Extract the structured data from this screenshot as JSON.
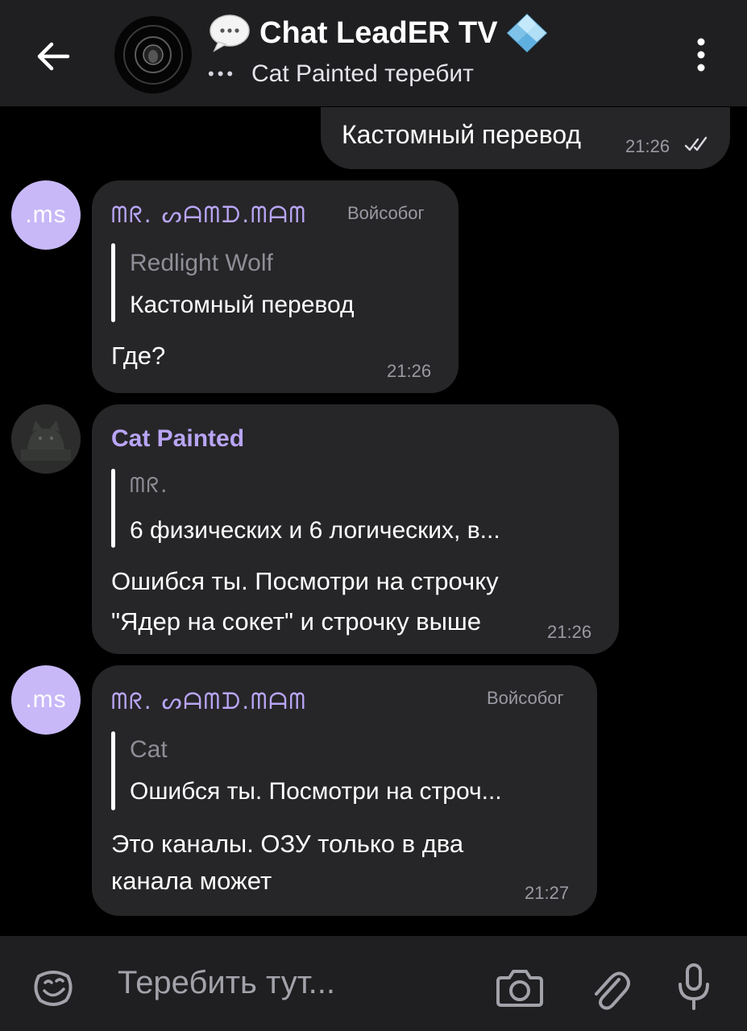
{
  "header": {
    "back_icon": "arrow-left-icon",
    "title_emoji_icon": "speech-bubble-icon",
    "title": "Chat LeadER TV",
    "verified_icon": "blue-diamond-icon",
    "typing_indicator": "•••",
    "typing_status": "Cat Painted теребит",
    "menu_icon": "more-vertical-icon"
  },
  "messages": [
    {
      "direction": "outgoing",
      "text": "Кастомный перевод",
      "time": "21:26",
      "status_icon": "double-check-icon"
    },
    {
      "direction": "incoming",
      "avatar_text": ".ms",
      "sender": "ᗰᖇ. ᔕᗩᗰᗪ.ᗰᗩᗰ",
      "role": "Войсобог",
      "quote": {
        "author": "Redlight Wolf",
        "text": "Кастомный перевод"
      },
      "text": "Где?",
      "time": "21:26"
    },
    {
      "direction": "incoming",
      "avatar_icon": "cat-avatar-icon",
      "sender": "Cat Painted",
      "quote": {
        "author": "ᗰᖇ.",
        "text": "6 физических и 6 логических, в..."
      },
      "text_lines": [
        "Ошибся ты. Посмотри на строчку",
        "\"Ядер на сокет\" и строчку выше"
      ],
      "time": "21:26"
    },
    {
      "direction": "incoming",
      "avatar_text": ".ms",
      "sender": "ᗰᖇ. ᔕᗩᗰᗪ.ᗰᗩᗰ",
      "role": "Войсобог",
      "quote": {
        "author": "Cat",
        "text": "Ошибся ты. Посмотри на строч..."
      },
      "text_lines": [
        "Это каналы. ОЗУ только в два",
        "канала может"
      ],
      "time": "21:27"
    }
  ],
  "input": {
    "emoji_icon": "sticker-smile-icon",
    "placeholder": "Теребить тут...",
    "camera_icon": "camera-icon",
    "attach_icon": "paperclip-icon",
    "mic_icon": "microphone-icon"
  },
  "colors": {
    "background": "#000000",
    "header": "#1f1f21",
    "bubble": "#262628",
    "accent": "#b9a5f5",
    "avatar_ms": "#c8b8f8"
  }
}
